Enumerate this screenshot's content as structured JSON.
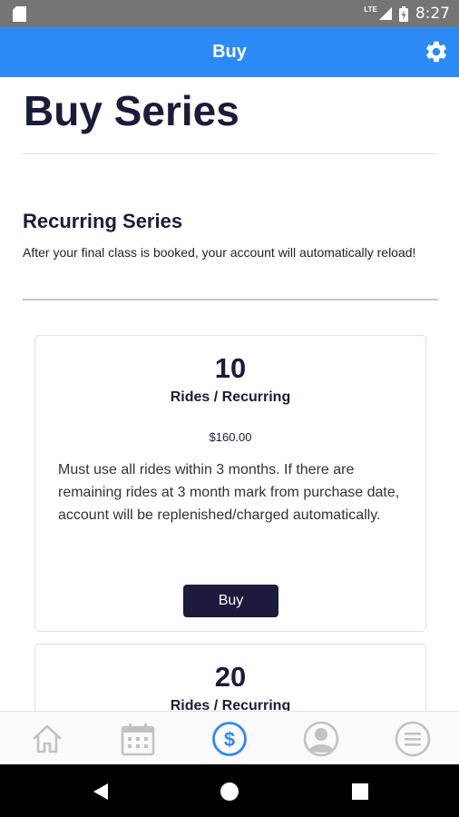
{
  "status_bar": {
    "time": "8:27",
    "network": "LTE",
    "icons": [
      "sd-card-icon",
      "signal-icon",
      "battery-icon"
    ]
  },
  "app_bar": {
    "title": "Buy",
    "settings_icon": "gear-icon",
    "color": "#2b8af6"
  },
  "main": {
    "page_title": "Buy Series",
    "section": {
      "title": "Recurring Series",
      "description": "After your final class is booked, your account will automatically reload!"
    },
    "cards": [
      {
        "count": "10",
        "type": "Rides / Recurring",
        "price": "$160.00",
        "description": "Must use all rides within 3 months. If there are remaining rides at 3 month mark from purchase date, account will be replenished/charged automatically.",
        "button_label": "Buy"
      },
      {
        "count": "20",
        "type": "Rides / Recurring"
      }
    ]
  },
  "bottom_nav": {
    "items": [
      {
        "name": "home",
        "icon": "home-icon",
        "active": false
      },
      {
        "name": "schedule",
        "icon": "calendar-icon",
        "active": false
      },
      {
        "name": "buy",
        "icon": "dollar-icon",
        "active": true
      },
      {
        "name": "account",
        "icon": "user-icon",
        "active": false
      },
      {
        "name": "menu",
        "icon": "menu-icon",
        "active": false
      }
    ],
    "active_color": "#2b8af6",
    "inactive_color": "#c2c2c2"
  },
  "system_nav": {
    "buttons": [
      "back-icon",
      "home-circle-icon",
      "recents-icon"
    ]
  },
  "colors": {
    "accent": "#2b8af6",
    "button_dark": "#1c1a3d",
    "text_dark": "#1c1b3a"
  }
}
